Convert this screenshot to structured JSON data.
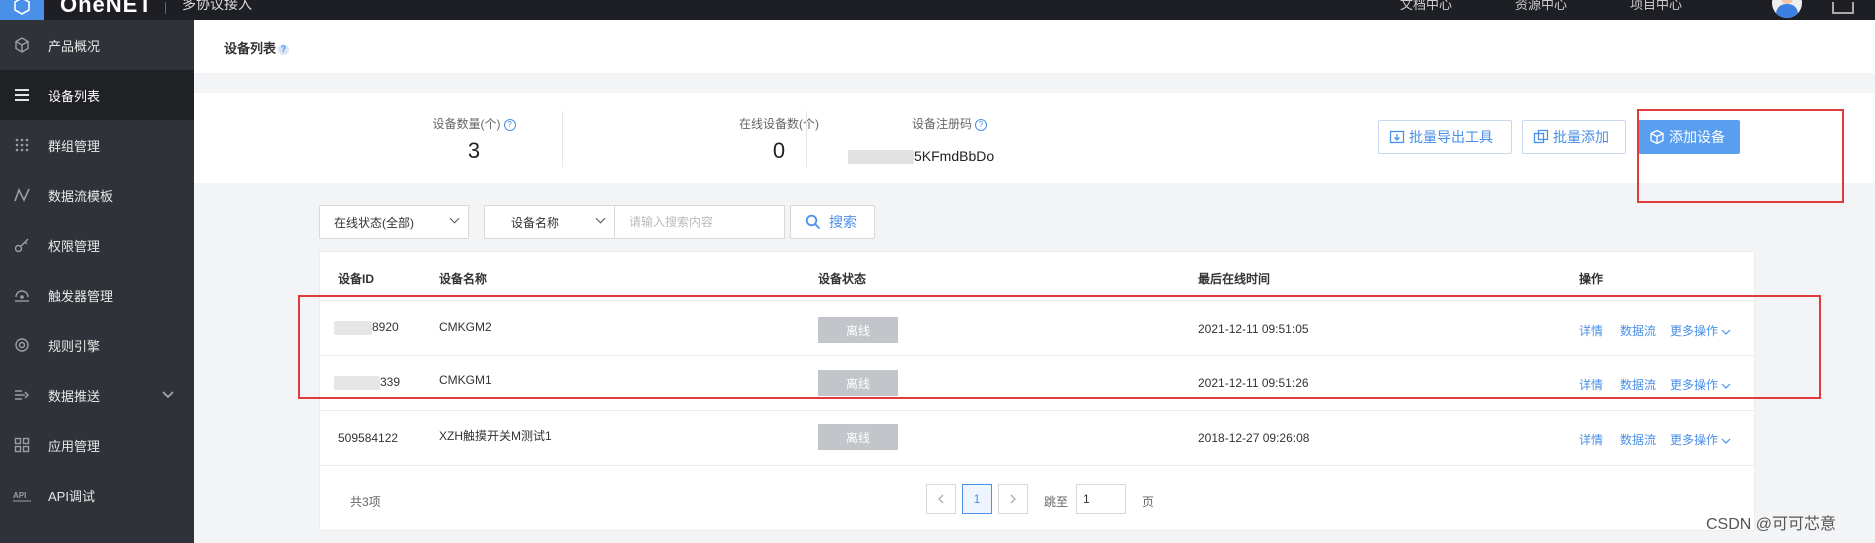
{
  "topbar": {
    "brand": "OneNET",
    "sub": "多协议接入",
    "links": [
      "文档中心",
      "资源中心",
      "项目中心"
    ]
  },
  "sidebar": {
    "items": [
      {
        "label": "产品概况",
        "icon": "cube-icon"
      },
      {
        "label": "设备列表",
        "icon": "list-icon",
        "active": true
      },
      {
        "label": "群组管理",
        "icon": "grid-dots-icon"
      },
      {
        "label": "数据流模板",
        "icon": "zigzag-icon"
      },
      {
        "label": "权限管理",
        "icon": "key-icon"
      },
      {
        "label": "触发器管理",
        "icon": "trigger-icon"
      },
      {
        "label": "规则引擎",
        "icon": "target-icon"
      },
      {
        "label": "数据推送",
        "icon": "push-icon",
        "expandable": true
      },
      {
        "label": "应用管理",
        "icon": "apps-icon"
      },
      {
        "label": "API调试",
        "icon": "api-icon"
      }
    ]
  },
  "header": {
    "title": "设备列表",
    "help": "?"
  },
  "stats": {
    "device_count_label": "设备数量(个)",
    "device_count": "3",
    "online_count_label": "在线设备数(个)",
    "online_count": "0",
    "reg_code_label": "设备注册码",
    "reg_code_visible": "5KFmdBbDo"
  },
  "actions": {
    "export_label": "批量导出工具",
    "batch_add_label": "批量添加",
    "add_device_label": "添加设备"
  },
  "filters": {
    "status_select": "在线状态(全部)",
    "field_select": "设备名称",
    "search_placeholder": "请输入搜索内容",
    "search_label": "搜索"
  },
  "table": {
    "columns": [
      "设备ID",
      "设备名称",
      "设备状态",
      "最后在线时间",
      "操作"
    ],
    "rows": [
      {
        "id_suffix": "8920",
        "name": "CMKGM2",
        "status": "离线",
        "last_online": "2021-12-11 09:51:05"
      },
      {
        "id_suffix": "339",
        "name": "CMKGM1",
        "status": "离线",
        "last_online": "2021-12-11 09:51:26"
      },
      {
        "id": "509584122",
        "name": "XZH触摸开关M测试1",
        "status": "离线",
        "last_online": "2018-12-27 09:26:08"
      }
    ],
    "ops": {
      "detail": "详情",
      "datastream": "数据流",
      "more": "更多操作"
    }
  },
  "pager": {
    "total": "共3项",
    "current_page": "1",
    "jump_label": "跳至",
    "jump_value": "1",
    "page_unit": "页"
  },
  "watermark": "CSDN @可可芯意",
  "colors": {
    "accent": "#4a8fe8",
    "sidebar": "#2f3238",
    "highlight_border": "#e03a3a",
    "offline_badge": "#c2c5ca"
  }
}
